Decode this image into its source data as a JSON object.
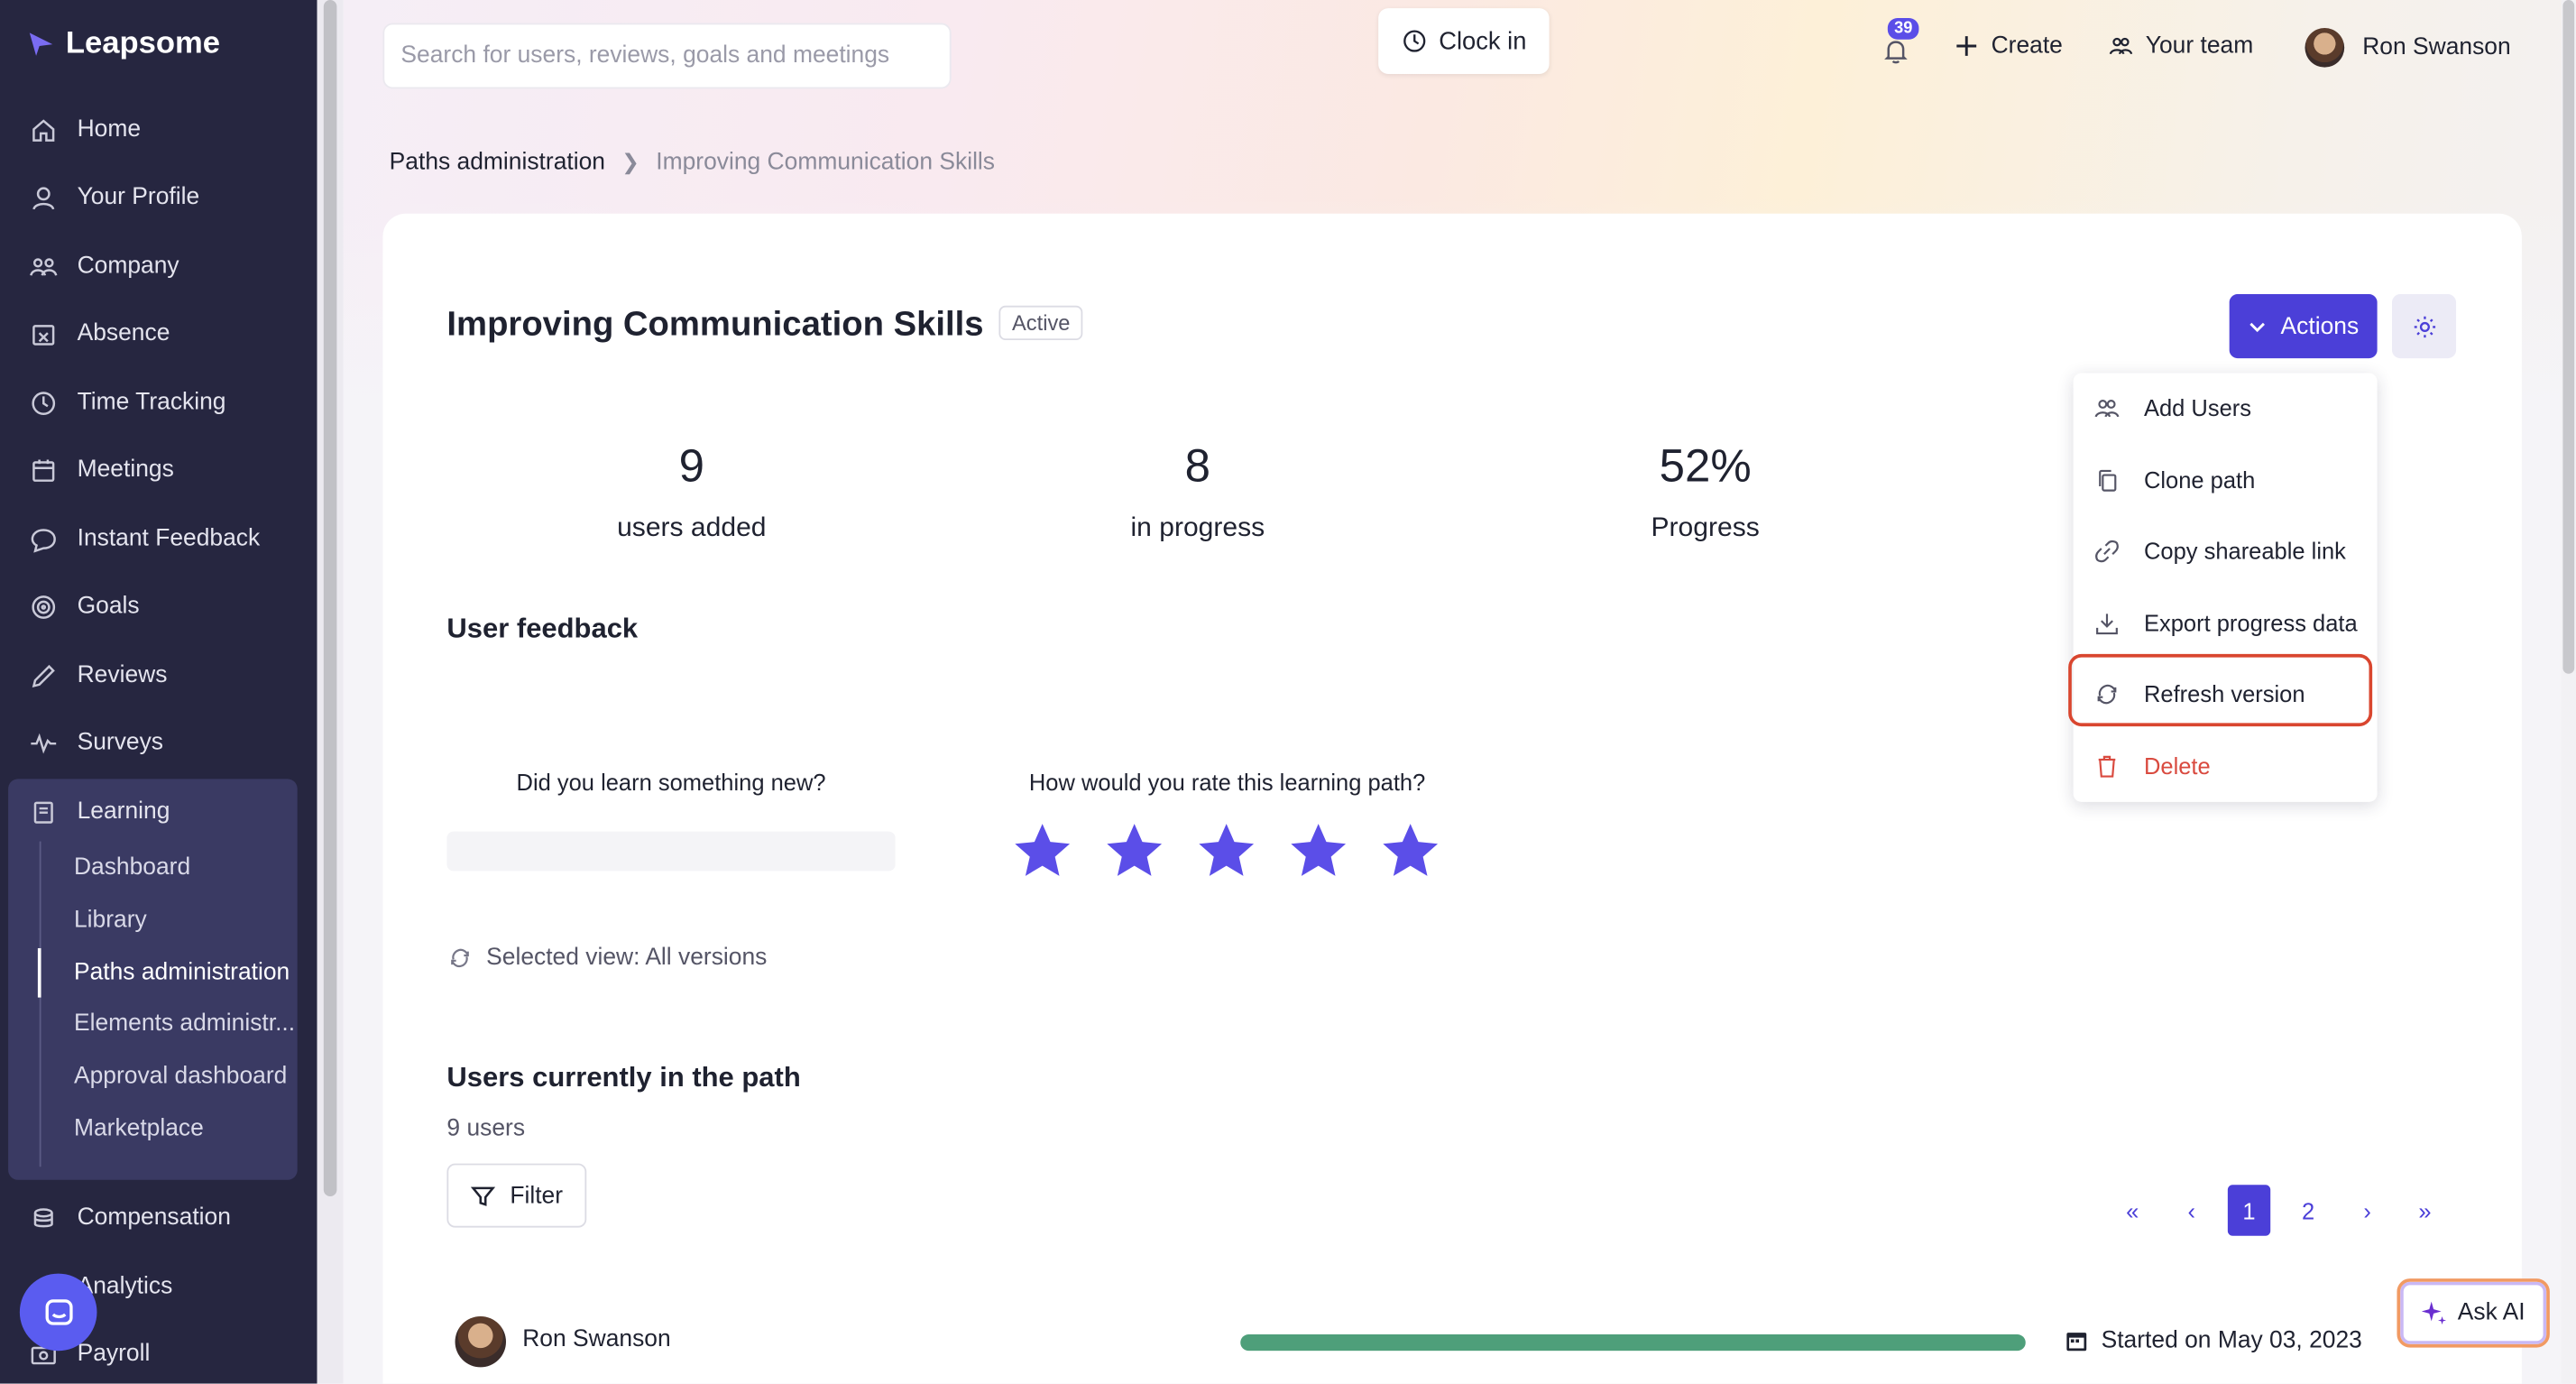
{
  "app": {
    "name": "Leapsome"
  },
  "sidebar": {
    "items": [
      {
        "label": "Home",
        "icon": "home-icon"
      },
      {
        "label": "Your Profile",
        "icon": "user-icon"
      },
      {
        "label": "Company",
        "icon": "company-icon"
      },
      {
        "label": "Absence",
        "icon": "calendar-x-icon"
      },
      {
        "label": "Time Tracking",
        "icon": "clock-icon"
      },
      {
        "label": "Meetings",
        "icon": "calendar-icon"
      },
      {
        "label": "Instant Feedback",
        "icon": "chat-icon"
      },
      {
        "label": "Goals",
        "icon": "target-icon"
      },
      {
        "label": "Reviews",
        "icon": "pencil-icon"
      },
      {
        "label": "Surveys",
        "icon": "pulse-icon"
      },
      {
        "label": "Learning",
        "icon": "book-icon"
      }
    ],
    "learning_sub": [
      {
        "label": "Dashboard"
      },
      {
        "label": "Library"
      },
      {
        "label": "Paths administration"
      },
      {
        "label": "Elements administr..."
      },
      {
        "label": "Approval dashboard"
      },
      {
        "label": "Marketplace"
      }
    ],
    "bottom_items": [
      {
        "label": "Compensation",
        "icon": "coins-icon"
      },
      {
        "label": "Analytics",
        "icon": "chart-icon"
      },
      {
        "label": "Payroll",
        "icon": "payroll-icon"
      }
    ]
  },
  "topbar": {
    "search_placeholder": "Search for users, reviews, goals and meetings",
    "clock_in": "Clock in",
    "notifications_count": "39",
    "create": "Create",
    "your_team": "Your team",
    "user_name": "Ron Swanson"
  },
  "breadcrumb": {
    "parent": "Paths administration",
    "current": "Improving Communication Skills"
  },
  "path": {
    "title": "Improving Communication Skills",
    "status": "Active",
    "actions_label": "Actions",
    "stats": [
      {
        "value": "9",
        "label": "users added"
      },
      {
        "value": "8",
        "label": "in progress"
      },
      {
        "value": "52%",
        "label": "Progress"
      }
    ]
  },
  "feedback": {
    "heading": "User feedback",
    "q1": "Did you learn something new?",
    "q2": "How would you rate this learning path?",
    "rating": 5,
    "rating_max": 5,
    "star_color": "#5b4ee8"
  },
  "selected_view": "Selected view: All versions",
  "users_section": {
    "heading": "Users currently in the path",
    "count": "9 users",
    "filter_label": "Filter"
  },
  "pagination": {
    "first": "«",
    "prev": "‹",
    "pages": [
      "1",
      "2"
    ],
    "current": "1",
    "next": "›",
    "last": "»"
  },
  "user_rows": [
    {
      "name": "Ron Swanson",
      "progress": 1.0,
      "started": "Started on May 03, 2023"
    }
  ],
  "actions_menu": [
    {
      "label": "Add Users",
      "icon": "users-icon"
    },
    {
      "label": "Clone path",
      "icon": "copy-icon"
    },
    {
      "label": "Copy shareable link",
      "icon": "link-icon"
    },
    {
      "label": "Export progress data",
      "icon": "download-icon"
    },
    {
      "label": "Refresh version",
      "icon": "refresh-icon"
    },
    {
      "label": "Delete",
      "icon": "trash-icon"
    }
  ],
  "ask_ai": "Ask AI",
  "colors": {
    "accent": "#4b3fd8",
    "sidebar_bg": "#262640",
    "danger": "#d94a3f",
    "progress": "#4e9f7a",
    "highlight": "#d9462f"
  }
}
